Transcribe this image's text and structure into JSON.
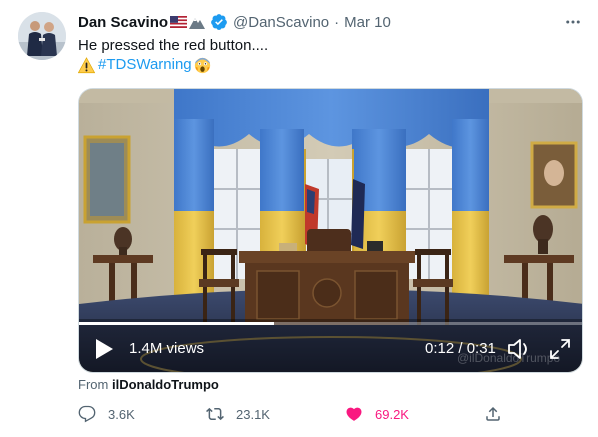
{
  "author": {
    "display_name": "Dan Scavino",
    "handle": "@DanScavino",
    "separator": "·",
    "date": "Mar 10"
  },
  "tweet": {
    "text": "He pressed the red button....",
    "hashtag": "#TDSWarning"
  },
  "video": {
    "views": "1.4M views",
    "time": "0:12 / 0:31",
    "progress": 0.387,
    "watermark": "@ilDonaldoTrumpo"
  },
  "attribution": {
    "prefix": "From",
    "user": "ilDonaldoTrumpo"
  },
  "actions": {
    "replies": "3.6K",
    "retweets": "23.1K",
    "likes": "69.2K"
  },
  "icons": {
    "more": "more-icon",
    "verified": "verified-badge-icon",
    "play": "play-icon",
    "volume": "volume-icon",
    "fullscreen": "fullscreen-icon",
    "reply": "reply-icon",
    "retweet": "retweet-icon",
    "like": "heart-icon",
    "share": "share-icon"
  },
  "colors": {
    "accent": "#1d9bf0",
    "like": "#f91880",
    "secondary_text": "#536471"
  }
}
